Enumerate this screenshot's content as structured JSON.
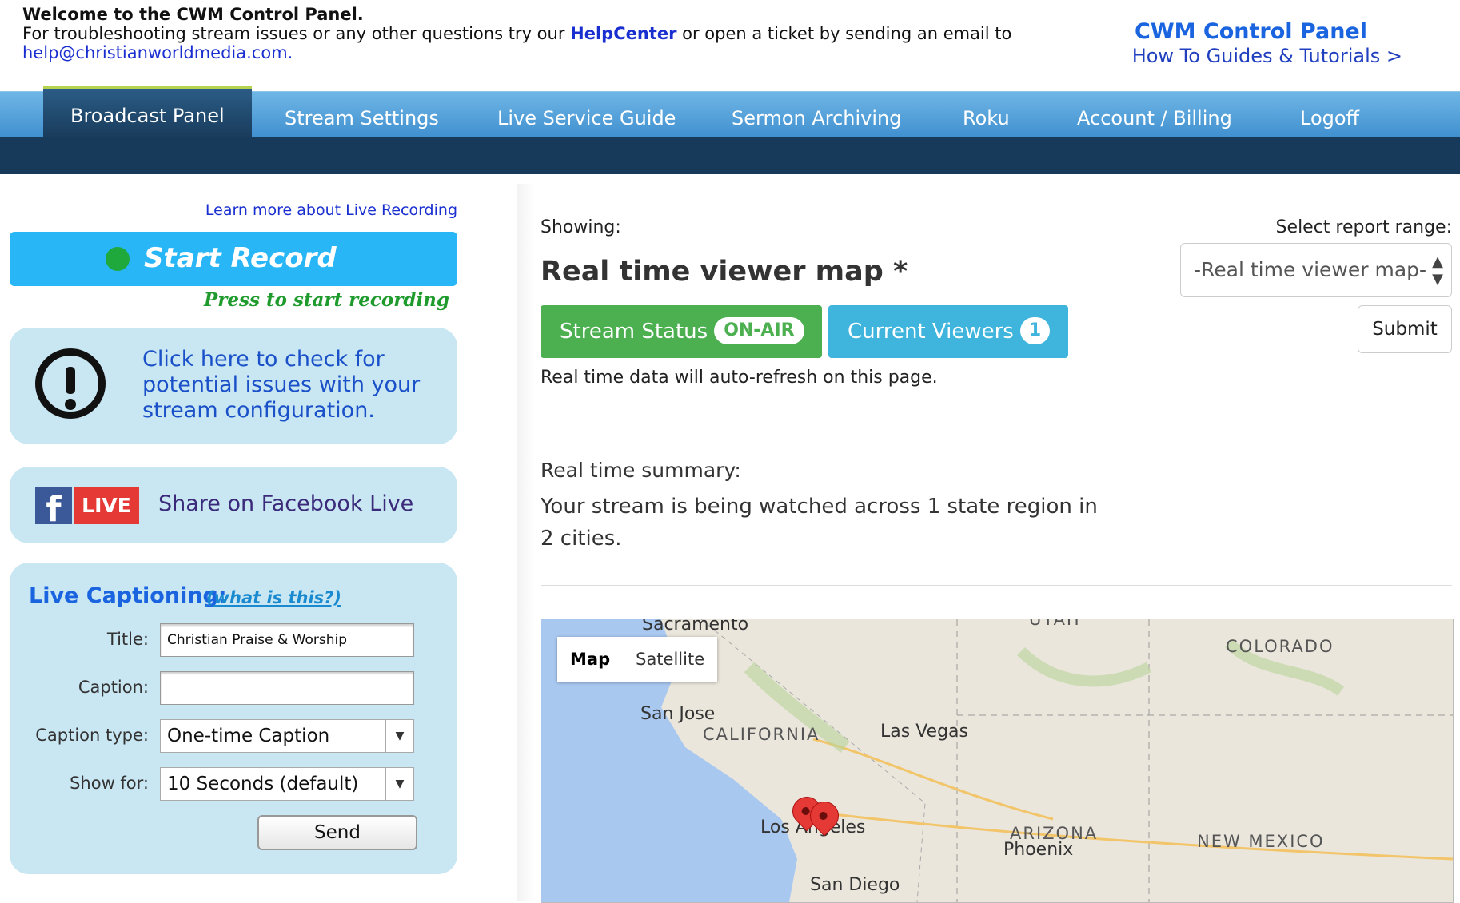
{
  "header": {
    "welcome": "Welcome to the CWM Control Panel.",
    "line2_pre": "For troubleshooting stream issues or any other questions try our ",
    "helpcenter": "HelpCenter",
    "line2_post": " or open a ticket by sending an email to",
    "email": "help@christianworldmedia.com.",
    "brand_title": "CWM Control Panel",
    "guides": "How To Guides & Tutorials >"
  },
  "nav": {
    "tabs": [
      "Broadcast Panel",
      "Stream Settings",
      "Live Service Guide",
      "Sermon Archiving",
      "Roku",
      "Account / Billing",
      "Logoff"
    ],
    "active": "Broadcast Panel"
  },
  "left": {
    "learn_more": "Learn more about Live Recording",
    "record_label": "Start Record",
    "record_hint": "Press to start recording",
    "check_text": "Click here to check for potential issues with your stream configuration.",
    "fb_f": "f",
    "fb_live": "LIVE",
    "fb_text": "Share on Facebook Live",
    "captioning": {
      "title": "Live Captioning:",
      "what": "(what is this?)",
      "title_label": "Title:",
      "title_value": "Christian Praise & Worship",
      "caption_label": "Caption:",
      "caption_value": "",
      "type_label": "Caption type:",
      "type_value": "One-time Caption",
      "show_label": "Show for:",
      "show_value": "10 Seconds (default)",
      "send": "Send"
    }
  },
  "main": {
    "showing": "Showing:",
    "heading": "Real time viewer map *",
    "status_label": "Stream Status",
    "status_value": "ON-AIR",
    "viewers_label": "Current Viewers",
    "viewers_value": "1",
    "refresh_note": "Real time data will auto-refresh on this page.",
    "summary_title": "Real time summary:",
    "summary_text": "Your stream is being watched across 1 state region in 2 cities.",
    "range_label": "Select report range:",
    "range_value": "-Real time viewer map-",
    "submit": "Submit"
  },
  "map": {
    "toggle": [
      "Map",
      "Satellite"
    ],
    "cities": [
      "Sacramento",
      "San Jose",
      "Las Vegas",
      "Los Angeles",
      "San Diego",
      "Phoenix"
    ],
    "states": [
      "CALIFORNIA",
      "ARIZONA",
      "COLORADO",
      "NEW MEXICO",
      "UTAH"
    ],
    "colors": {
      "water": "#a9c8f0",
      "land": "#eae6dc",
      "pin": "#e53935"
    }
  }
}
